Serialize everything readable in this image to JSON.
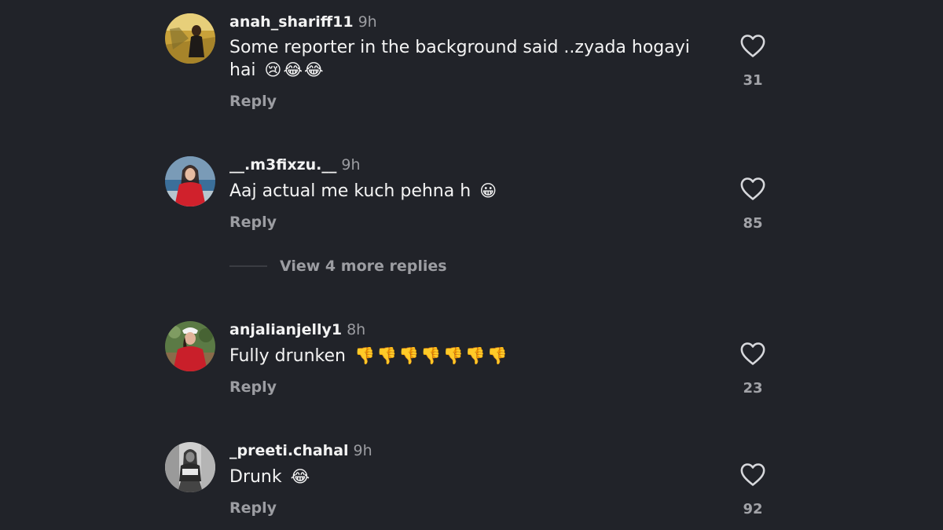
{
  "comments": [
    {
      "username": "anah_shariff11",
      "time": "9h",
      "text": "Some reporter in the background said ..zyada hogayi hai",
      "emoji": "😢😂😂",
      "reply_label": "Reply",
      "likes": "31",
      "avatar_icon": "user-avatar-photo"
    },
    {
      "username": "__.m3fixzu.__",
      "time": "9h",
      "text": "Aaj actual me kuch pehna h",
      "emoji": "😀",
      "reply_label": "Reply",
      "likes": "85",
      "avatar_icon": "user-avatar-photo"
    },
    {
      "username": "anjalianjelly1",
      "time": "8h",
      "text": "Fully drunken",
      "emoji": "👎👎👎👎👎👎👎",
      "reply_label": "Reply",
      "likes": "23",
      "avatar_icon": "user-avatar-photo"
    },
    {
      "username": "_preeti.chahal",
      "time": "9h",
      "text": "Drunk",
      "emoji": "😂",
      "reply_label": "Reply",
      "likes": "92",
      "avatar_icon": "user-avatar-photo"
    }
  ],
  "view_more_replies": "View 4 more replies",
  "colors": {
    "background": "#212329",
    "text": "#f4f4f4",
    "muted": "#9c9da2",
    "icon": "#d7d8dc"
  },
  "icons": {
    "like": "heart-outline-icon"
  }
}
